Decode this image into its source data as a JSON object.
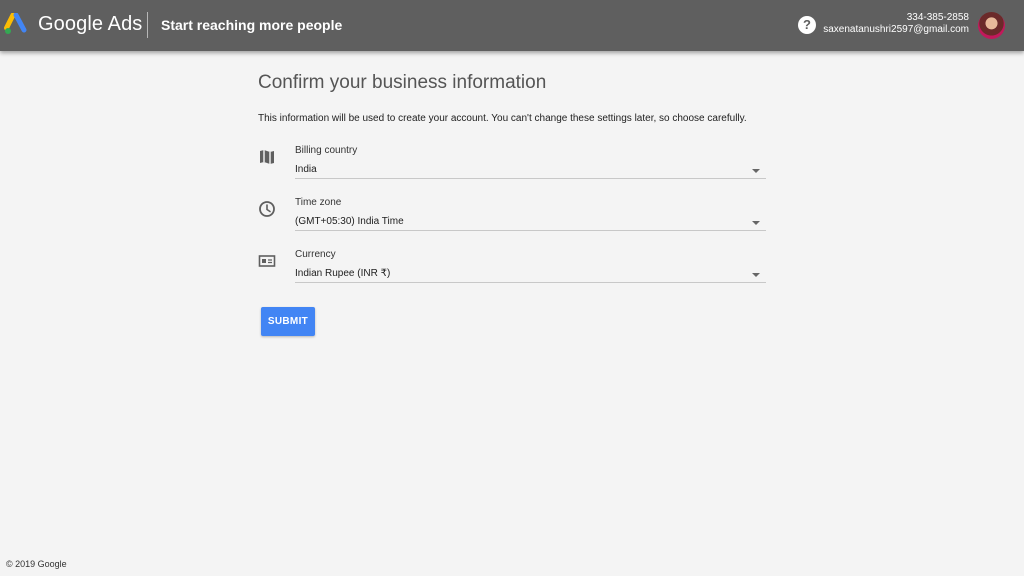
{
  "header": {
    "brand": "Google Ads",
    "subtitle": "Start reaching more people",
    "help_icon": "help-circle-icon",
    "account": {
      "phone": "334-385-2858",
      "email": "saxenatanushri2597@gmail.com"
    }
  },
  "main": {
    "title": "Confirm your business information",
    "description": "This information will be used to create your account. You can't change these settings later, so choose carefully.",
    "fields": [
      {
        "label": "Billing country",
        "value": "India",
        "icon": "map-icon"
      },
      {
        "label": "Time zone",
        "value": "(GMT+05:30) India Time",
        "icon": "clock-icon"
      },
      {
        "label": "Currency",
        "value": "Indian Rupee (INR ₹)",
        "icon": "currency-icon"
      }
    ],
    "submit_label": "SUBMIT"
  },
  "footer": {
    "copyright": "© 2019 Google"
  },
  "colors": {
    "topbar": "#5f5f5f",
    "background": "#f4f4f4",
    "button": "#4285f4",
    "logo_blue": "#4285f4",
    "logo_yellow": "#fbbc04",
    "logo_green": "#34a853"
  }
}
